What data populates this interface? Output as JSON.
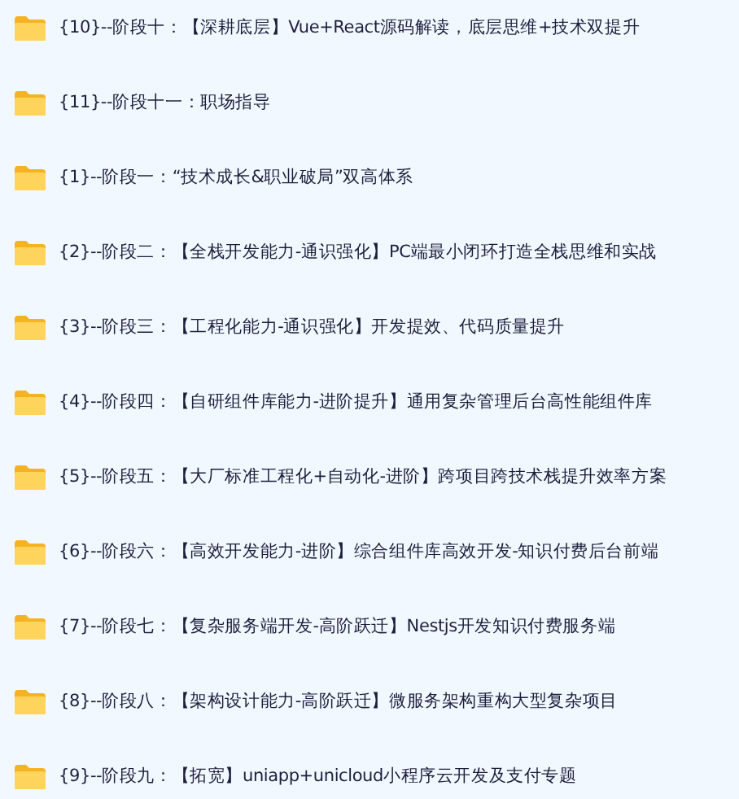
{
  "folders": [
    {
      "name": "{10}--阶段十：【深耕底层】Vue+React源码解读，底层思维+技术双提升"
    },
    {
      "name": "{11}--阶段十一：职场指导"
    },
    {
      "name": "{1}--阶段一：“技术成长&职业破局”双高体系"
    },
    {
      "name": "{2}--阶段二：【全栈开发能力-通识强化】PC端最小闭环打造全栈思维和实战"
    },
    {
      "name": "{3}--阶段三：【工程化能力-通识强化】开发提效、代码质量提升"
    },
    {
      "name": "{4}--阶段四：【自研组件库能力-进阶提升】通用复杂管理后台高性能组件库"
    },
    {
      "name": "{5}--阶段五：【大厂标准工程化+自动化-进阶】跨项目跨技术栈提升效率方案"
    },
    {
      "name": "{6}--阶段六：【高效开发能力-进阶】综合组件库高效开发-知识付费后台前端"
    },
    {
      "name": "{7}--阶段七：【复杂服务端开发-高阶跃迁】Nestjs开发知识付费服务端"
    },
    {
      "name": "{8}--阶段八：【架构设计能力-高阶跃迁】微服务架构重构大型复杂项目"
    },
    {
      "name": "{9}--阶段九：【拓宽】uniapp+unicloud小程序云开发及支付专题"
    }
  ]
}
